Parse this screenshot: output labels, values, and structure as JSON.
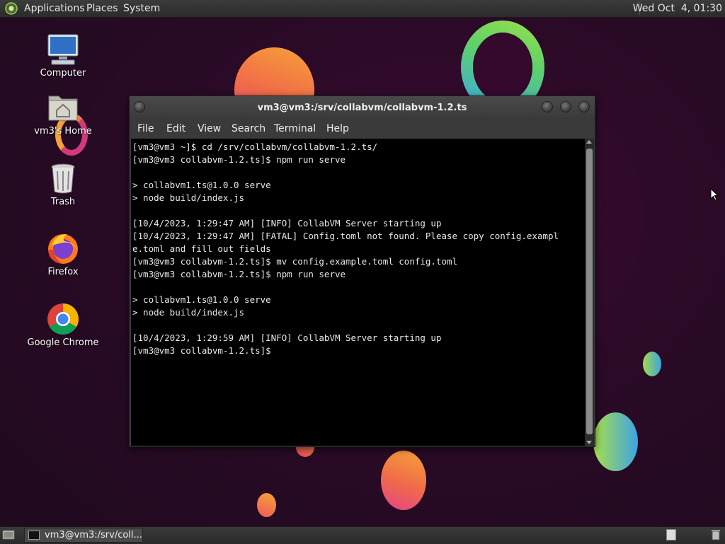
{
  "top_panel": {
    "menus": [
      "Applications",
      "Places",
      "System"
    ],
    "clock": "Wed Oct  4, 01:30"
  },
  "desktop_icons": [
    {
      "label": "Computer",
      "icon": "computer-icon"
    },
    {
      "label": "vm3's Home",
      "icon": "home-folder-icon"
    },
    {
      "label": "Trash",
      "icon": "trash-icon"
    },
    {
      "label": "Firefox",
      "icon": "firefox-icon"
    },
    {
      "label": "Google Chrome",
      "icon": "chrome-icon"
    }
  ],
  "terminal": {
    "title": "vm3@vm3:/srv/collabvm/collabvm-1.2.ts",
    "menu": [
      "File",
      "Edit",
      "View",
      "Search",
      "Terminal",
      "Help"
    ],
    "lines": [
      "[vm3@vm3 ~]$ cd /srv/collabvm/collabvm-1.2.ts/",
      "[vm3@vm3 collabvm-1.2.ts]$ npm run serve",
      "",
      "> collabvm1.ts@1.0.0 serve",
      "> node build/index.js",
      "",
      "[10/4/2023, 1:29:47 AM] [INFO] CollabVM Server starting up",
      "[10/4/2023, 1:29:47 AM] [FATAL] Config.toml not found. Please copy config.exampl",
      "e.toml and fill out fields",
      "[vm3@vm3 collabvm-1.2.ts]$ mv config.example.toml config.toml",
      "[vm3@vm3 collabvm-1.2.ts]$ npm run serve",
      "",
      "> collabvm1.ts@1.0.0 serve",
      "> node build/index.js",
      "",
      "[10/4/2023, 1:29:59 AM] [INFO] CollabVM Server starting up",
      "[vm3@vm3 collabvm-1.2.ts]$ "
    ]
  },
  "taskbar": {
    "task_label": "vm3@vm3:/srv/coll..."
  },
  "colors": {
    "desktop_bg": "#2a0a26",
    "terminal_bg": "#000000",
    "terminal_fg": "#e8e8e8",
    "panel_bg": "#2f2f2f"
  }
}
